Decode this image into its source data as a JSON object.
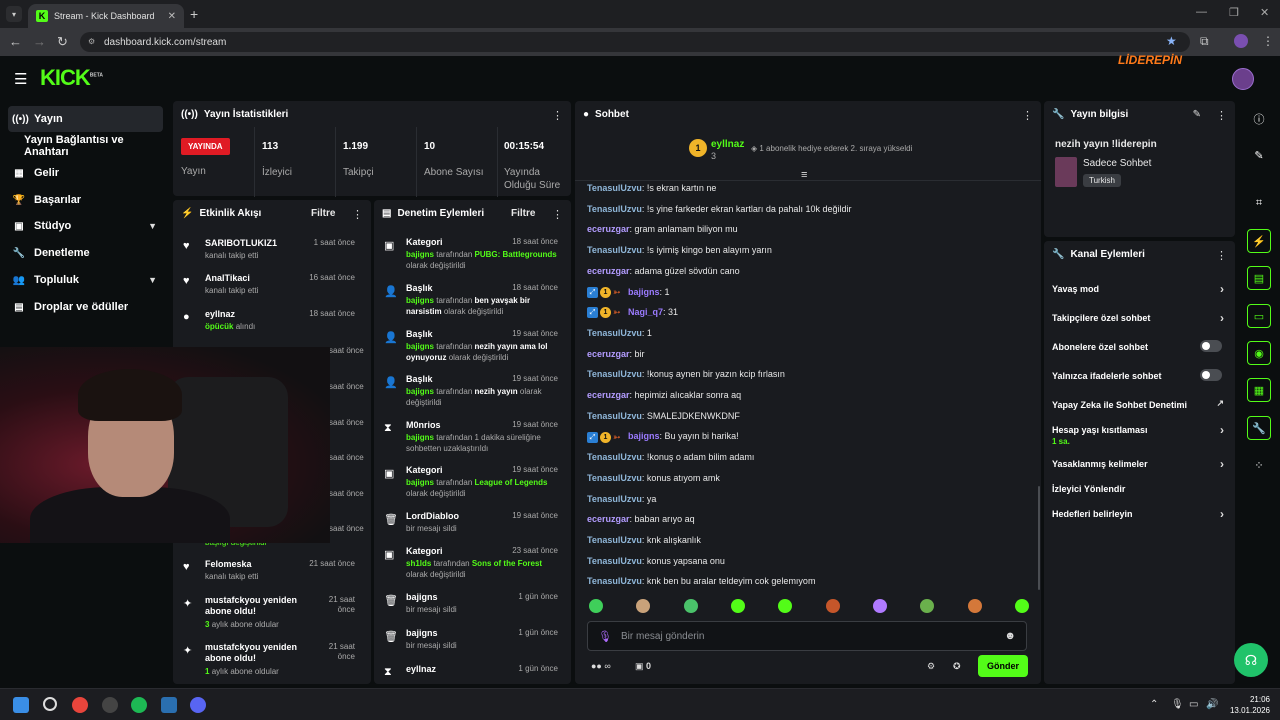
{
  "browser": {
    "tab_title": "Stream - Kick Dashboard",
    "url": "dashboard.kick.com/stream"
  },
  "header": {
    "logo": "KICK",
    "logo_beta": "BETA",
    "brand": "LİDEREPİN"
  },
  "sidebar": {
    "items": [
      {
        "label": "Yayın",
        "icon": "broadcast-icon"
      },
      {
        "label": "Yayın Bağlantısı ve Anahtarı",
        "icon": ""
      },
      {
        "label": "Gelir",
        "icon": "revenue-icon"
      },
      {
        "label": "Başarılar",
        "icon": "trophy-icon"
      },
      {
        "label": "Stüdyo",
        "icon": "studio-icon"
      },
      {
        "label": "Denetleme",
        "icon": "wrench-icon"
      },
      {
        "label": "Topluluk",
        "icon": "community-icon"
      },
      {
        "label": "Droplar ve ödüller",
        "icon": "drops-icon"
      }
    ]
  },
  "stats": {
    "title": "Yayın İstatistikleri",
    "live_label": "YAYINDA",
    "status_label": "Yayın",
    "items": [
      {
        "value": "113",
        "label": "İzleyici"
      },
      {
        "value": "1.199",
        "label": "Takipçi"
      },
      {
        "value": "10",
        "label": "Abone Sayısı"
      },
      {
        "value": "00:15:54",
        "label": "Yayında Olduğu Süre"
      }
    ]
  },
  "activity": {
    "title": "Etkinlik Akışı",
    "filter": "Filtre",
    "items": [
      {
        "user": "SARIBOTLUKIZ1",
        "sub": "kanalı takip etti",
        "time": "1 saat önce",
        "icon": "♥"
      },
      {
        "user": "AnalTikaci",
        "sub": "kanalı takip etti",
        "time": "16 saat önce",
        "icon": "♥"
      },
      {
        "user": "eyllnaz",
        "sub_hl": "öpücük",
        "sub": "alındı",
        "time": "18 saat önce",
        "icon": "⬤"
      },
      {
        "user": "Felomeska",
        "sub": "kanalı takip etti",
        "time": "21 saat önce",
        "icon": "♥"
      },
      {
        "user": "mustafckyou yeniden abone oldu!",
        "sub_hl": "3",
        "sub": "aylık abone oldular",
        "time": "21 saat önce",
        "icon": "✦"
      },
      {
        "user": "mustafckyou yeniden abone oldu!",
        "sub_hl": "1",
        "sub": "aylık abone oldular",
        "time": "21 saat önce",
        "icon": "✦"
      }
    ],
    "hidden_times": [
      "saat önce",
      "saat önce",
      "saat önce",
      "saat önce",
      "saat önce",
      "saat önce"
    ],
    "hidden_fragment": "başlığı değiştirildi"
  },
  "audit": {
    "title": "Denetim Eylemleri",
    "filter": "Filtre",
    "items": [
      {
        "title": "Kategori",
        "time": "18 saat önce",
        "actor": "bajigns",
        "mid": "tarafından",
        "value": "PUBG: Battlegrounds",
        "tail": "olarak değiştirildi",
        "icon": "▣"
      },
      {
        "title": "Başlık",
        "time": "18 saat önce",
        "actor": "bajigns",
        "mid": "tarafından",
        "value": "ben yavşak bir narsistim",
        "tail": "olarak değiştirildi",
        "icon": "👤"
      },
      {
        "title": "Başlık",
        "time": "19 saat önce",
        "actor": "bajigns",
        "mid": "tarafından",
        "value": "nezih yayın ama lol oynuyoruz",
        "tail": "olarak değiştirildi",
        "icon": "👤"
      },
      {
        "title": "Başlık",
        "time": "19 saat önce",
        "actor": "bajigns",
        "mid": "tarafından",
        "value": "nezih yayın",
        "tail": "olarak değiştirildi",
        "icon": "👤"
      },
      {
        "title": "M0nrios",
        "time": "19 saat önce",
        "actor": "bajigns",
        "mid": "tarafından 1 dakika süreliğine",
        "value": "",
        "tail": "sohbetten uzaklaştırıldı",
        "icon": "⧗"
      },
      {
        "title": "Kategori",
        "time": "19 saat önce",
        "actor": "bajigns",
        "mid": "tarafından",
        "value": "League of Legends",
        "tail": "olarak değiştirildi",
        "icon": "▣"
      },
      {
        "title": "LordDiabloo",
        "time": "19 saat önce",
        "actor": "",
        "mid": "",
        "value": "",
        "tail": "bir mesajı sildi",
        "icon": "🗑"
      },
      {
        "title": "Kategori",
        "time": "23 saat önce",
        "actor": "sh1lds",
        "mid": "tarafından",
        "value": "Sons of the Forest",
        "tail": "olarak değiştirildi",
        "icon": "▣"
      },
      {
        "title": "bajigns",
        "time": "1 gün önce",
        "actor": "",
        "mid": "",
        "value": "",
        "tail": "bir mesajı sildi",
        "icon": "🗑"
      },
      {
        "title": "bajigns",
        "time": "1 gün önce",
        "actor": "",
        "mid": "",
        "value": "",
        "tail": "bir mesajı sildi",
        "icon": "🗑"
      },
      {
        "title": "eyllnaz",
        "time": "1 gün önce",
        "actor": "",
        "mid": "",
        "value": "",
        "tail": "",
        "icon": "⧗"
      }
    ]
  },
  "chat": {
    "title": "Sohbet",
    "pinned_user": "eyllnaz",
    "pinned_rank": "1",
    "pinned_count": "3",
    "pinned_text": "1 abonelik hediye ederek 2. sıraya yükseldi",
    "messages": [
      {
        "user": "TenasulUzvu",
        "text": "!s ekran kartın ne",
        "color": "blue"
      },
      {
        "user": "TenasulUzvu",
        "text": "!s yine farkeder ekran kartları da pahalı 10k değildir",
        "color": "blue"
      },
      {
        "user": "eceruzgar",
        "text": "gram anlamam biliyon mu",
        "color": "purple"
      },
      {
        "user": "TenasulUzvu",
        "text": "!s iyimiş kingo ben alayım yarın",
        "color": "blue"
      },
      {
        "user": "eceruzgar",
        "text": "adama güzel sövdün cano",
        "color": "purple"
      },
      {
        "user": "bajigns",
        "text": "1",
        "color": "violet",
        "badges": true
      },
      {
        "user": "Nagi_q7",
        "text": "31",
        "color": "violet",
        "badges": true
      },
      {
        "user": "TenasulUzvu",
        "text": "1",
        "color": "blue"
      },
      {
        "user": "eceruzgar",
        "text": "bir",
        "color": "purple"
      },
      {
        "user": "TenasulUzvu",
        "text": "!konuş aynen bir yazın kcip fırlasın",
        "color": "blue"
      },
      {
        "user": "eceruzgar",
        "text": "hepimizi alıcaklar sonra aq",
        "color": "purple"
      },
      {
        "user": "TenasulUzvu",
        "text": "SMALEJDKENWKDNF",
        "color": "blue"
      },
      {
        "user": "bajigns",
        "text": "Bu yayın bi harika!",
        "color": "violet",
        "badges": true
      },
      {
        "user": "TenasulUzvu",
        "text": "!konuş o adam bilim adamı",
        "color": "blue"
      },
      {
        "user": "TenasulUzvu",
        "text": "konus atıyom amk",
        "color": "blue"
      },
      {
        "user": "TenasulUzvu",
        "text": "ya",
        "color": "blue"
      },
      {
        "user": "eceruzgar",
        "text": "baban arıyo aq",
        "color": "purple"
      },
      {
        "user": "TenasulUzvu",
        "text": "knk alışkanlık",
        "color": "blue"
      },
      {
        "user": "TenasulUzvu",
        "text": "konus yapsana onu",
        "color": "blue"
      },
      {
        "user": "TenasulUzvu",
        "text": "knk ben bu aralar teldeyim cok gelemıyom",
        "color": "blue"
      }
    ],
    "input_placeholder": "Bir mesaj gönderin",
    "send_label": "Gönder",
    "points_label": "∞",
    "chest_count": "0",
    "emote_colors": [
      "#3fcf5a",
      "#c9a27a",
      "#4ac26a",
      "#53fc18",
      "#53fc18",
      "#c5562a",
      "#b07aff",
      "#6ab04c",
      "#d4783a",
      "#53fc18"
    ]
  },
  "stream_info": {
    "title": "Yayın bilgisi",
    "stream_title": "nezih yayın !liderepin",
    "category": "Sadece Sohbet",
    "language": "Turkish"
  },
  "channel_actions": {
    "title": "Kanal Eylemleri",
    "items": [
      {
        "label": "Yavaş mod",
        "type": "arrow"
      },
      {
        "label": "Takipçilere özel sohbet",
        "type": "arrow"
      },
      {
        "label": "Abonelere özel sohbet",
        "type": "toggle"
      },
      {
        "label": "Yalnızca ifadelerle sohbet",
        "type": "toggle"
      },
      {
        "label": "Yapay Zeka ile Sohbet Denetimi",
        "type": "external"
      },
      {
        "label": "Hesap yaşı kısıtlaması",
        "sub": "1 sa.",
        "type": "arrow"
      },
      {
        "label": "Yasaklanmış kelimeler",
        "type": "arrow"
      },
      {
        "label": "İzleyici Yönlendir",
        "type": "none"
      },
      {
        "label": "Hedefleri belirleyin",
        "type": "arrow"
      }
    ]
  },
  "taskbar": {
    "time": "21:06",
    "date": "13.01.2026"
  },
  "colors": {
    "accent": "#53fc18",
    "live": "#e01b24",
    "panel": "#191b1f",
    "bg": "#0b0e0f"
  }
}
